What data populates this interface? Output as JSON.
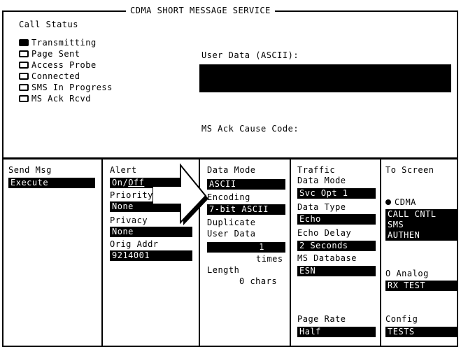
{
  "screen": {
    "title": "CDMA SHORT MESSAGE SERVICE"
  },
  "call_status": {
    "label": "Call Status",
    "items": [
      {
        "label": "Transmitting",
        "checked": true
      },
      {
        "label": "Page Sent",
        "checked": false
      },
      {
        "label": "Access Probe",
        "checked": false
      },
      {
        "label": "Connected",
        "checked": false
      },
      {
        "label": "SMS In Progress",
        "checked": false
      },
      {
        "label": "MS Ack Rcvd",
        "checked": false
      }
    ]
  },
  "user_data": {
    "label": "User Data (ASCII):",
    "value": ""
  },
  "ms_ack": {
    "label": "MS Ack Cause Code:",
    "value": ""
  },
  "send_msg": {
    "label": "Send Msg",
    "value": "Execute"
  },
  "alert": {
    "label": "Alert",
    "on": "On/",
    "off": "Off",
    "priority_label": "Priority",
    "priority": "None",
    "privacy_label": "Privacy",
    "privacy": "None",
    "orig_label": "Orig Addr",
    "orig": "9214001"
  },
  "data_mode": {
    "label": "Data Mode",
    "value": "ASCII",
    "encoding_label": "Encoding",
    "encoding": "7-bit ASCII",
    "duplicate_label": "Duplicate",
    "user_data_label": "User Data",
    "user_data_value": "1",
    "times_label": "times",
    "length_label": "Length",
    "length_value": "0 chars"
  },
  "traffic": {
    "label1": "Traffic",
    "label2": "Data Mode",
    "value": "Svc Opt 1",
    "data_type_label": "Data Type",
    "data_type": "Echo",
    "echo_delay_label": "Echo Delay",
    "echo_delay": "2 Seconds",
    "ms_db_label": "MS Database",
    "ms_db": "ESN",
    "page_rate_label": "Page Rate",
    "page_rate": "Half"
  },
  "to_screen": {
    "label": "To Screen",
    "cdma_label": "CDMA",
    "items": [
      "CALL CNTL",
      "SMS",
      "AUTHEN"
    ],
    "analog_label": "Analog",
    "analog_item": "RX TEST",
    "config_label": "Config",
    "config_item": "TESTS"
  },
  "arrow": {
    "icon": "pointer-arrow-icon"
  }
}
